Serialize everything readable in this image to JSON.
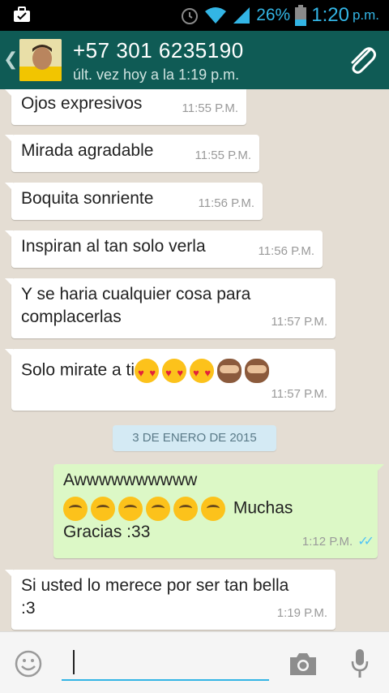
{
  "status_bar": {
    "battery_percent": "26%",
    "time": "1:20",
    "ampm": "p.m."
  },
  "header": {
    "contact": "+57 301 6235190",
    "last_seen": "últ. vez hoy a la 1:19 p.m."
  },
  "messages": [
    {
      "dir": "in",
      "text": "Ojos expresivos",
      "time": "11:55 P.M."
    },
    {
      "dir": "in",
      "text": "Mirada agradable",
      "time": "11:55 P.M."
    },
    {
      "dir": "in",
      "text": "Boquita sonriente",
      "time": "11:56 P.M."
    },
    {
      "dir": "in",
      "text": "Inspiran al tan solo verla",
      "time": "11:56 P.M."
    },
    {
      "dir": "in",
      "text_line1": "Y se haria cualquier cosa para",
      "text_line2": "complacerlas",
      "time": "11:57 P.M."
    },
    {
      "dir": "in",
      "text": "Solo mirate a ti",
      "time": "11:57 P.M."
    },
    {
      "dir": "out",
      "text_line1": "Awwwwwwwwww",
      "text_line2_suffix": "Muchas",
      "text_line3": "Gracias :33",
      "time": "1:12 P.M."
    },
    {
      "dir": "in",
      "text_line1": "Si usted lo merece por ser tan bella",
      "text_line2": ":3",
      "time": "1:19 P.M."
    }
  ],
  "date_divider": "3 DE ENERO DE 2015",
  "icons": {
    "briefcase": "briefcase-icon",
    "alarm": "alarm-icon",
    "wifi": "wifi-icon",
    "signal": "signal-icon",
    "battery": "battery-icon",
    "back": "back-chevron-icon",
    "attach": "paperclip-icon",
    "emoji": "smiley-icon",
    "camera": "camera-icon",
    "mic": "mic-icon",
    "read": "double-check-icon"
  },
  "colors": {
    "action_bar": "#0f5b55",
    "status_accent": "#33b5e5",
    "chat_bg": "#e4ddd3",
    "outgoing_bubble": "#dcf8c6",
    "read_ticks": "#4fc3f7"
  }
}
